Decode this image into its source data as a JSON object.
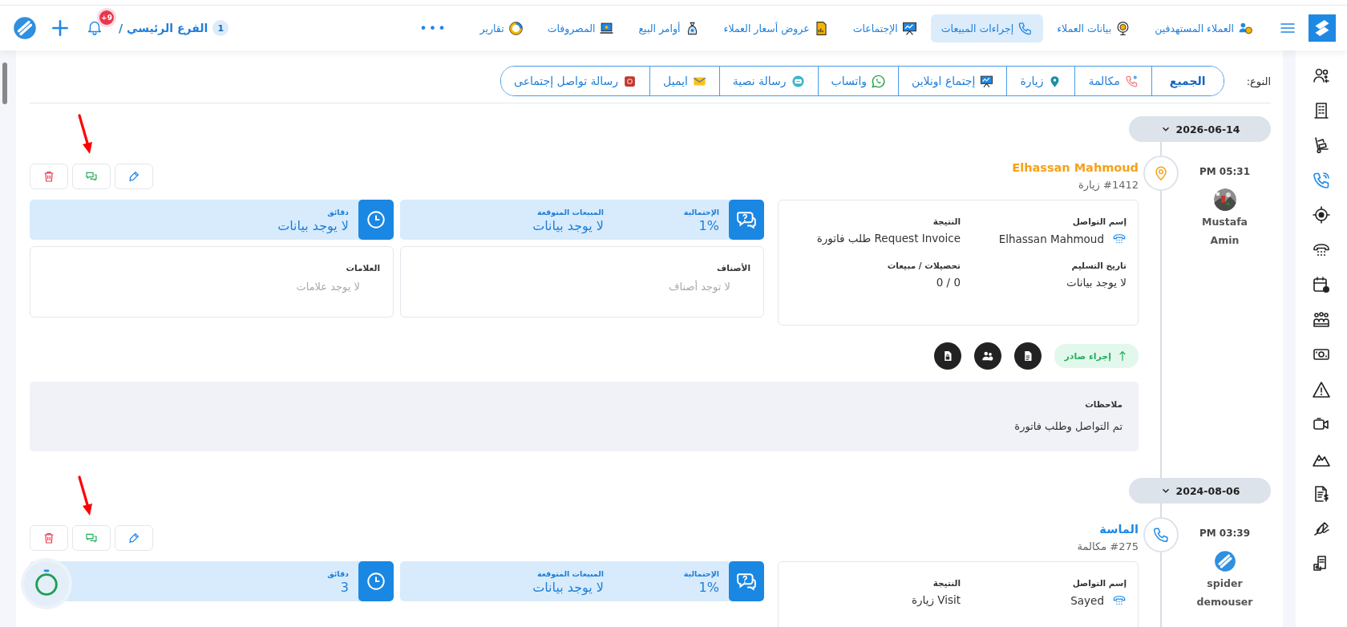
{
  "topbar": {
    "nav": [
      {
        "label": "العملاء المستهدفين",
        "selected": false
      },
      {
        "label": "بيانات العملاء",
        "selected": false
      },
      {
        "label": "إجراءات المبيعات",
        "selected": true
      },
      {
        "label": "الإجتماعات",
        "selected": false
      },
      {
        "label": "عروض أسعار العملاء",
        "selected": false
      },
      {
        "label": "أوامر البيع",
        "selected": false
      },
      {
        "label": "المصروفات",
        "selected": false
      },
      {
        "label": "تقارير",
        "selected": false
      }
    ],
    "more": "•••",
    "branch": {
      "number": "1",
      "name": "الفرع الرئيسي /"
    },
    "notifications": "+9"
  },
  "sidebar": {
    "items": [
      {
        "selected": false
      },
      {
        "selected": false
      },
      {
        "selected": false
      },
      {
        "selected": true
      },
      {
        "selected": false
      },
      {
        "selected": false
      },
      {
        "selected": false
      },
      {
        "selected": false
      },
      {
        "selected": false
      },
      {
        "selected": false
      },
      {
        "selected": false
      },
      {
        "selected": false
      },
      {
        "selected": false
      },
      {
        "selected": false
      },
      {
        "selected": false
      }
    ]
  },
  "filter": {
    "label": "النوع:",
    "options": [
      {
        "label": "الجميع",
        "selected": true
      },
      {
        "label": "مكالمة",
        "selected": false
      },
      {
        "label": "زيارة",
        "selected": false
      },
      {
        "label": "إجتماع اونلاين",
        "selected": false
      },
      {
        "label": "واتساب",
        "selected": false
      },
      {
        "label": "رسالة نصية",
        "selected": false
      },
      {
        "label": "ايميل",
        "selected": false
      },
      {
        "label": "رسالة تواصل إجتماعى",
        "selected": false
      }
    ]
  },
  "timeline": [
    {
      "date": "2026-06-14",
      "entry": {
        "kind": "visit",
        "color": "#f5a11c",
        "time": "PM 05:31",
        "user": "Mustafa Amin",
        "title": "Elhassan Mahmoud",
        "subtitle": "#1412 زيارة",
        "fields": [
          {
            "kind": "contact",
            "label": "إسم التواصل",
            "value": "Elhassan Mahmoud"
          },
          {
            "kind": "text",
            "label": "النتيجة",
            "value": "Request Invoice طلب فاتورة"
          },
          {
            "kind": "text",
            "label": "تاريخ التسليم",
            "value": "لا يوجد بيانات"
          },
          {
            "kind": "text",
            "label": "تحصيلات / مبيعات",
            "value": "0 / 0"
          }
        ],
        "tiles": [
          {
            "kind": "probability",
            "items": [
              {
                "label": "الإحتمالية",
                "value": "1%"
              },
              {
                "label": "المبيعات المتوقعة",
                "value": "لا يوجد بيانات"
              }
            ]
          },
          {
            "kind": "duration",
            "items": [
              {
                "label": "دقائق",
                "value": "لا يوجد بيانات"
              }
            ]
          }
        ],
        "boxes": [
          {
            "label": "الأصناف",
            "value": "لا توجد أصناف"
          },
          {
            "label": "العلامات",
            "value": "لا يوجد علامات"
          }
        ],
        "direction": "إجراء صادر",
        "notes": {
          "label": "ملاحظات",
          "text": "تم التواصل وطلب فاتورة"
        }
      }
    },
    {
      "date": "2024-08-06",
      "entry": {
        "kind": "call",
        "color": "#1e88e5",
        "time": "PM 03:39",
        "avatar": {
          "kind": "logo"
        },
        "user": "spider demouser",
        "title": "الماسة",
        "subtitle": "#275 مكالمة",
        "fields": [
          {
            "kind": "contact",
            "label": "إسم التواصل",
            "value": "Sayed"
          },
          {
            "kind": "text",
            "label": "النتيجة",
            "value": "Visit زيارة"
          }
        ],
        "tiles": [
          {
            "kind": "probability",
            "items": [
              {
                "label": "الإحتمالية",
                "value": "1%"
              },
              {
                "label": "المبيعات المتوقعة",
                "value": "لا يوجد بيانات"
              }
            ]
          },
          {
            "kind": "duration",
            "items": [
              {
                "label": "دقائق",
                "value": "3"
              }
            ]
          }
        ]
      }
    }
  ]
}
